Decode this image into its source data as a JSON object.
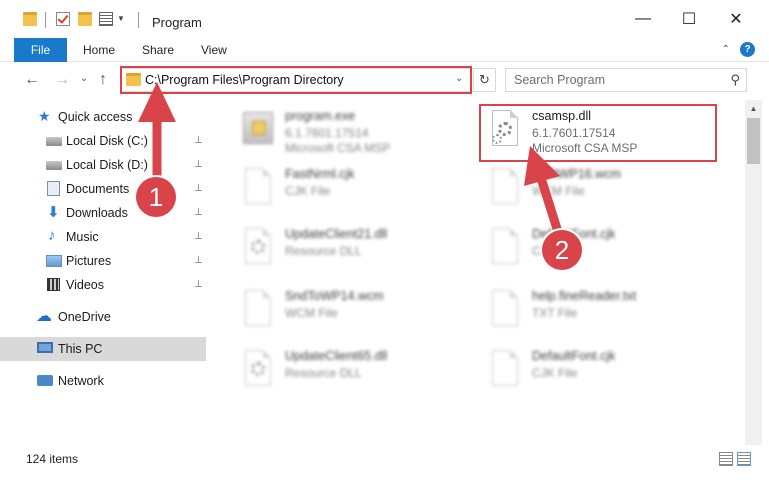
{
  "window": {
    "title": "Program",
    "minimize": "—",
    "maximize": "☐",
    "close": "✕"
  },
  "ribbon": {
    "tabs": [
      "File",
      "Home",
      "Share",
      "View"
    ],
    "help": "?",
    "collapse": "⌃"
  },
  "nav": {
    "back": "←",
    "forward": "→",
    "up_dropdown": "⌄",
    "up": "↑",
    "address": "C:\\Program Files\\Program Directory",
    "address_dropdown": "⌄",
    "refresh": "↻",
    "search_placeholder": "Search Program",
    "search_icon": "⚲"
  },
  "sidebar": {
    "items": [
      {
        "label": "Quick access",
        "icon": "star-icon",
        "pinned": false
      },
      {
        "label": "Local Disk (C:)",
        "icon": "disk-icon",
        "pinned": true
      },
      {
        "label": "Local Disk (D:)",
        "icon": "disk-icon",
        "pinned": true
      },
      {
        "label": "Documents",
        "icon": "documents-icon",
        "pinned": true
      },
      {
        "label": "Downloads",
        "icon": "download-icon",
        "pinned": true
      },
      {
        "label": "Music",
        "icon": "music-icon",
        "pinned": true
      },
      {
        "label": "Pictures",
        "icon": "pictures-icon",
        "pinned": true
      },
      {
        "label": "Videos",
        "icon": "videos-icon",
        "pinned": true
      },
      {
        "label": "OneDrive",
        "icon": "cloud-icon",
        "pinned": false
      },
      {
        "label": "This PC",
        "icon": "computer-icon",
        "pinned": false,
        "selected": true
      },
      {
        "label": "Network",
        "icon": "network-icon",
        "pinned": false
      }
    ],
    "pin_glyph": "📌"
  },
  "files": [
    {
      "name": "program.exe",
      "line2": "6.1.7601.17514",
      "line3": "Microsoft CSA MSP",
      "type": "exe",
      "highlighted": false
    },
    {
      "name": "csamsp.dll",
      "line2": "6.1.7601.17514",
      "line3": "Microsoft CSA MSP",
      "type": "dll",
      "highlighted": true
    },
    {
      "name": "FastNrml.cjk",
      "line2": "CJK File",
      "line3": "",
      "type": "page",
      "highlighted": false
    },
    {
      "name": "DefltWP16.wcm",
      "line2": "WCM File",
      "line3": "",
      "type": "page",
      "highlighted": false
    },
    {
      "name": "UpdateClient21.dll",
      "line2": "Resource DLL",
      "line3": "",
      "type": "dll",
      "highlighted": false
    },
    {
      "name": "DefaultFont.cjk",
      "line2": "CJK File",
      "line3": "",
      "type": "page",
      "highlighted": false
    },
    {
      "name": "SndToWP14.wcm",
      "line2": "WCM File",
      "line3": "",
      "type": "page",
      "highlighted": false
    },
    {
      "name": "help.fineReader.txt",
      "line2": "TXT File",
      "line3": "",
      "type": "page",
      "highlighted": false
    },
    {
      "name": "UpdateClient65.dll",
      "line2": "Resource DLL",
      "line3": "",
      "type": "dll",
      "highlighted": false
    },
    {
      "name": "DefaultFont.cjk",
      "line2": "CJK File",
      "line3": "",
      "type": "page",
      "highlighted": false
    }
  ],
  "status": {
    "item_count": "124 items"
  },
  "annotations": {
    "badge1": "1",
    "badge2": "2",
    "color": "#d9434a"
  },
  "colors": {
    "accent": "#1979ca",
    "selection": "#d9d9d9",
    "annotation": "#d9434a"
  }
}
